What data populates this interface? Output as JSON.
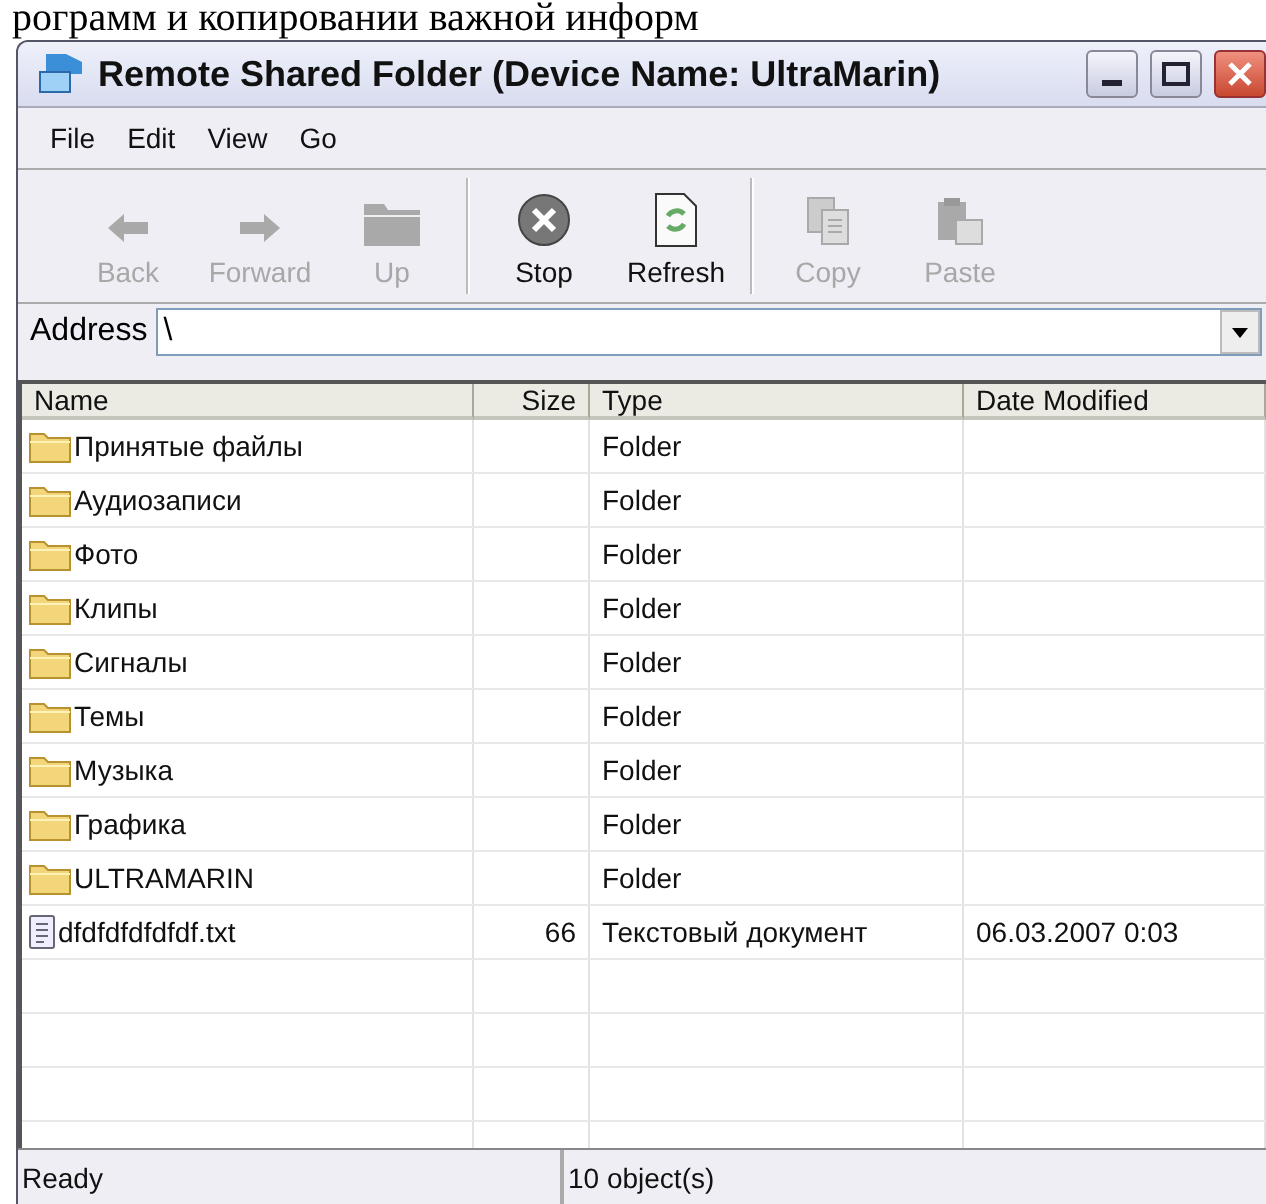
{
  "page_text": "рограмм и копировании важной информ",
  "window": {
    "title": "Remote Shared Folder (Device Name: UltraMarin)"
  },
  "menu": [
    "File",
    "Edit",
    "View",
    "Go"
  ],
  "toolbar": [
    {
      "kind": "back",
      "label": "Back",
      "disabled": true
    },
    {
      "kind": "forward",
      "label": "Forward",
      "disabled": true
    },
    {
      "kind": "up",
      "label": "Up",
      "disabled": true
    },
    {
      "kind": "stop",
      "label": "Stop",
      "disabled": false
    },
    {
      "kind": "refresh",
      "label": "Refresh",
      "disabled": false
    },
    {
      "kind": "copy",
      "label": "Copy",
      "disabled": true
    },
    {
      "kind": "paste",
      "label": "Paste",
      "disabled": true
    }
  ],
  "address": {
    "label": "Address",
    "value": "\\"
  },
  "table": {
    "columns": [
      "Name",
      "Size",
      "Type",
      "Date Modified"
    ],
    "rows": [
      {
        "kind": "folder",
        "name": "Принятые файлы",
        "type": "Folder"
      },
      {
        "kind": "folder",
        "name": "Аудиозаписи",
        "type": "Folder"
      },
      {
        "kind": "folder",
        "name": "Фото",
        "type": "Folder"
      },
      {
        "kind": "folder",
        "name": "Клипы",
        "type": "Folder"
      },
      {
        "kind": "folder",
        "name": "Сигналы",
        "type": "Folder"
      },
      {
        "kind": "folder",
        "name": "Темы",
        "type": "Folder"
      },
      {
        "kind": "folder",
        "name": "Музыка",
        "type": "Folder"
      },
      {
        "kind": "folder",
        "name": "Графика",
        "type": "Folder"
      },
      {
        "kind": "folder",
        "name": "ULTRAMARIN",
        "type": "Folder"
      },
      {
        "kind": "file",
        "name": "dfdfdfdfdfdf.txt",
        "size": "66",
        "type": "Текстовый документ",
        "date_modified": "06.03.2007 0:03"
      }
    ]
  },
  "status_bar": {
    "status": "Ready",
    "count": "10 object(s)"
  }
}
